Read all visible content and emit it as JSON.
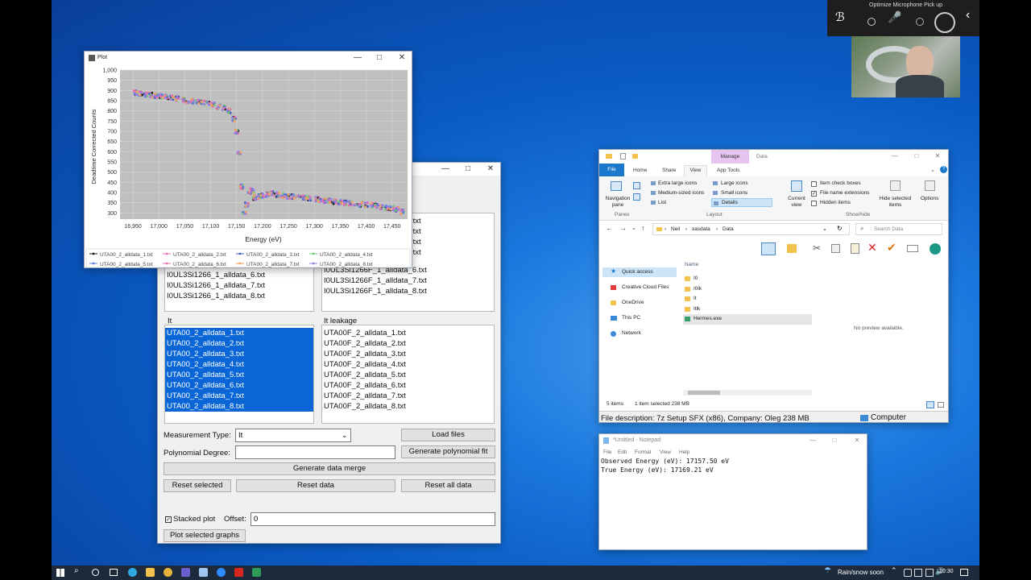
{
  "colors": {
    "accent": "#0a66d6",
    "desktop": "#1b78de",
    "taskbar": "#1c2a3c",
    "plotbg": "#bfbfbf"
  },
  "overlay": {
    "title": "Optimize Microphone Pick up"
  },
  "plot": {
    "window_title": "Plot",
    "chart_data": {
      "type": "scatter",
      "xlabel": "Energy (eV)",
      "ylabel": "Deadtime Corrected Counts",
      "xlim": [
        16925,
        17480
      ],
      "ylim": [
        270,
        1000
      ],
      "x_ticks": [
        "16,950",
        "17,000",
        "17,050",
        "17,100",
        "17,150",
        "17,200",
        "17,250",
        "17,300",
        "17,350",
        "17,400",
        "17,450"
      ],
      "y_ticks": [
        "1,000",
        "950",
        "900",
        "850",
        "800",
        "750",
        "700",
        "650",
        "600",
        "550",
        "500",
        "450",
        "400",
        "350",
        "300"
      ],
      "grid": true,
      "legend_position": "bottom",
      "series": [
        {
          "name": "UTA00_2_alldata_1.txt",
          "color": "#1a1a1a"
        },
        {
          "name": "UTA00_2_alldata_2.txt",
          "color": "#e66fb4"
        },
        {
          "name": "UTA00_2_alldata_3.txt",
          "color": "#3f5fbf"
        },
        {
          "name": "UTA00_2_alldata_4.txt",
          "color": "#6fc96f"
        },
        {
          "name": "UTA00_2_alldata_5.txt",
          "color": "#5b7fe0"
        },
        {
          "name": "UTA00_2_alldata_6.txt",
          "color": "#e06fb0"
        },
        {
          "name": "UTA00_2_alldata_7.txt",
          "color": "#f0a060"
        },
        {
          "name": "UTA00_2_alldata_8.txt",
          "color": "#9a7fe0"
        }
      ],
      "x": [
        16955,
        16965,
        16975,
        16985,
        16995,
        17005,
        17015,
        17025,
        17035,
        17045,
        17055,
        17065,
        17075,
        17085,
        17095,
        17105,
        17115,
        17125,
        17135,
        17145,
        17150,
        17155,
        17160,
        17165,
        17170,
        17175,
        17180,
        17185,
        17190,
        17200,
        17210,
        17220,
        17230,
        17240,
        17250,
        17260,
        17270,
        17280,
        17290,
        17300,
        17310,
        17320,
        17330,
        17340,
        17350,
        17360,
        17370,
        17380,
        17390,
        17400,
        17410,
        17420,
        17430,
        17440,
        17450,
        17460,
        17470
      ],
      "y": [
        890,
        885,
        880,
        878,
        875,
        872,
        868,
        865,
        860,
        855,
        850,
        848,
        845,
        840,
        835,
        830,
        820,
        815,
        800,
        760,
        700,
        600,
        430,
        300,
        340,
        390,
        410,
        375,
        380,
        385,
        390,
        395,
        390,
        385,
        380,
        380,
        378,
        375,
        372,
        368,
        365,
        360,
        360,
        355,
        352,
        350,
        348,
        345,
        342,
        340,
        338,
        335,
        330,
        325,
        322,
        318,
        305
      ]
    }
  },
  "app": {
    "upper_left_items": [
      "I0UL3Si1266_1_alldata_6.txt",
      "I0UL3Si1266_1_alldata_7.txt",
      "I0UL3Si1266_1_alldata_8.txt"
    ],
    "upper_right_items": [
      "I0UL3Si1266F_1_alldata_6.txt",
      "I0UL3Si1266F_1_alldata_7.txt",
      "I0UL3Si1266F_1_alldata_8.txt"
    ],
    "upper_right_partial": [
      ".txt",
      ".txt",
      ".txt",
      ".txt"
    ],
    "it_label": "It",
    "it_items": [
      "UTA00_2_alldata_1.txt",
      "UTA00_2_alldata_2.txt",
      "UTA00_2_alldata_3.txt",
      "UTA00_2_alldata_4.txt",
      "UTA00_2_alldata_5.txt",
      "UTA00_2_alldata_6.txt",
      "UTA00_2_alldata_7.txt",
      "UTA00_2_alldata_8.txt"
    ],
    "leak_label": "It leakage",
    "leak_items": [
      "UTA00F_2_alldata_1.txt",
      "UTA00F_2_alldata_2.txt",
      "UTA00F_2_alldata_3.txt",
      "UTA00F_2_alldata_4.txt",
      "UTA00F_2_alldata_5.txt",
      "UTA00F_2_alldata_6.txt",
      "UTA00F_2_alldata_7.txt",
      "UTA00F_2_alldata_8.txt"
    ],
    "measurement_label": "Measurement Type:",
    "measurement_value": "It",
    "load_files": "Load files",
    "poly_label": "Polynomial Degree:",
    "poly_value": "",
    "gen_poly": "Generate polynomial fit",
    "gen_merge": "Generate data merge",
    "reset_selected": "Reset selected",
    "reset_data": "Reset data",
    "reset_all": "Reset all data",
    "stacked_label": "Stacked plot",
    "offset_label": "Offset:",
    "offset_value": "0",
    "plot_selected": "Plot selected graphs"
  },
  "explorer": {
    "manage_tab": "Manage",
    "title": "Data",
    "tabs": [
      "File",
      "Home",
      "Share",
      "View",
      "App Tools"
    ],
    "layout_options": [
      "Extra large icons",
      "Large icons",
      "Medium-sized icons",
      "Small icons",
      "List",
      "Details"
    ],
    "nav_pane": "Navigation pane",
    "panes_label": "Panes",
    "layout_label": "Layout",
    "current_view": "Current view",
    "checks": [
      "Item check boxes",
      "File name extensions",
      "Hidden items"
    ],
    "hide_selected": "Hide selected items",
    "options": "Options",
    "showhide_label": "Show/hide",
    "path": [
      "Neil",
      "xasdata",
      "Data"
    ],
    "search_placeholder": "Search Data",
    "nav_items": [
      "Quick access",
      "Creative Cloud Files",
      "OneDrive",
      "This PC",
      "Network"
    ],
    "col_name": "Name",
    "files": [
      "I0",
      "I0lk",
      "It",
      "Itlk",
      "Hermes.exe"
    ],
    "preview": "No preview available.",
    "status_items": "5 items",
    "status_sel": "1 item selected  238 MB",
    "desc": "File description: 7z Setup SFX (x86), Company: Oleg 238 MB",
    "computer": "Computer"
  },
  "notepad": {
    "title": "*Untitled - Notepad",
    "menu": [
      "File",
      "Edit",
      "Format",
      "View",
      "Help"
    ],
    "lines": [
      "Observed Energy (eV): 17157.50 eV",
      "True Energy (eV): 17169.21 eV"
    ]
  },
  "taskbar": {
    "weather": "Rain/snow soon",
    "time": "10:30"
  }
}
